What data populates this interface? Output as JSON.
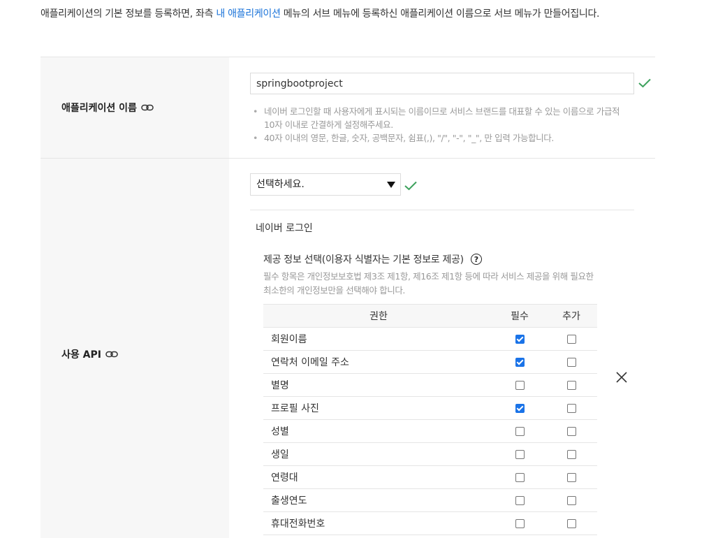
{
  "intro": {
    "text_before": "애플리케이션의 기본 정보를 등록하면, 좌측 ",
    "link": "내 애플리케이션",
    "text_after": " 메뉴의 서브 메뉴에 등록하신 애플리케이션 이름으로 서브 메뉴가 만들어집니다."
  },
  "app_name": {
    "label": "애플리케이션 이름",
    "value": "springbootproject",
    "hints": [
      "네이버 로그인할 때 사용자에게 표시되는 이름이므로 서비스 브랜드를 대표할 수 있는 이름으로 가급적 10자 이내로 간결하게 설정해주세요.",
      "40자 이내의 영문, 한글, 숫자, 공백문자, 쉼표(,), \"/\", \"-\", \"_\", 만 입력 가능합니다."
    ]
  },
  "api": {
    "label": "사용 API",
    "select_value": "선택하세요.",
    "api_name": "네이버 로그인",
    "provide_title": "제공 정보 선택(이용자 식별자는 기본 정보로 제공)",
    "help": "?",
    "provide_desc": "필수 항목은 개인정보보호법 제3조 제1항, 제16조 제1항 등에 따라 서비스 제공을 위해 필요한 최소한의 개인정보만을 선택해야 합니다.",
    "table": {
      "headers": [
        "권한",
        "필수",
        "추가"
      ],
      "rows": [
        {
          "name": "회원이름",
          "required": true,
          "extra": false
        },
        {
          "name": "연락처 이메일 주소",
          "required": true,
          "extra": false
        },
        {
          "name": "별명",
          "required": false,
          "extra": false
        },
        {
          "name": "프로필 사진",
          "required": true,
          "extra": false
        },
        {
          "name": "성별",
          "required": false,
          "extra": false
        },
        {
          "name": "생일",
          "required": false,
          "extra": false
        },
        {
          "name": "연령대",
          "required": false,
          "extra": false
        },
        {
          "name": "출생연도",
          "required": false,
          "extra": false
        },
        {
          "name": "휴대전화번호",
          "required": false,
          "extra": false
        }
      ]
    }
  },
  "colors": {
    "link": "#1a73d9",
    "valid_check": "#2db400",
    "checkbox_checked": "#1a73e8"
  }
}
